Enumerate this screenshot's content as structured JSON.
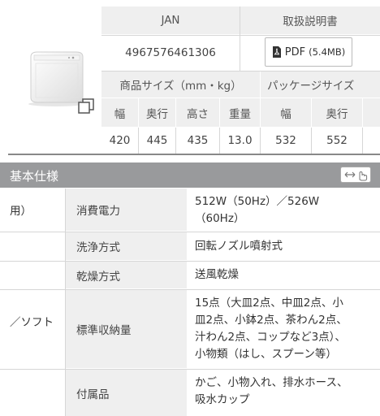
{
  "header": {
    "jan_label": "JAN",
    "manual_label": "取扱説明書",
    "jan_value": "4967576461306",
    "pdf_label": "PDF",
    "pdf_size": "(5.4MB)"
  },
  "dimensions": {
    "product_size_label": "商品サイズ（mm・kg）",
    "package_size_label": "パッケージサイズ",
    "cols": [
      "幅",
      "奥行",
      "高さ",
      "重量",
      "幅",
      "奥行"
    ],
    "values": [
      "420",
      "445",
      "435",
      "13.0",
      "532",
      "552"
    ]
  },
  "section": {
    "title": "基本仕様"
  },
  "specs": [
    {
      "left": "用）",
      "label": "消費電力",
      "value": [
        "512W（50Hz）／526W",
        "（60Hz）"
      ]
    },
    {
      "left": "",
      "label": "洗浄方式",
      "value": [
        "回転ノズル噴射式"
      ]
    },
    {
      "left": "",
      "label": "乾燥方式",
      "value": [
        "送風乾燥"
      ]
    },
    {
      "left": "／ソフト",
      "label": "標準収納量",
      "value": [
        "15点（大皿2点、中皿2点、小",
        "皿2点、小鉢2点、茶わん2点、",
        "汁わん2点、コップなど3点）、",
        "小物類（はし、スプーン等）"
      ]
    },
    {
      "left": "",
      "label": "付属品",
      "value": [
        "かご、小物入れ、排水ホース、",
        "吸水カップ"
      ]
    }
  ],
  "icons": {
    "expand": "expand-icon",
    "pdf": "pdf-icon",
    "scroll": "scroll-hint-icon"
  }
}
